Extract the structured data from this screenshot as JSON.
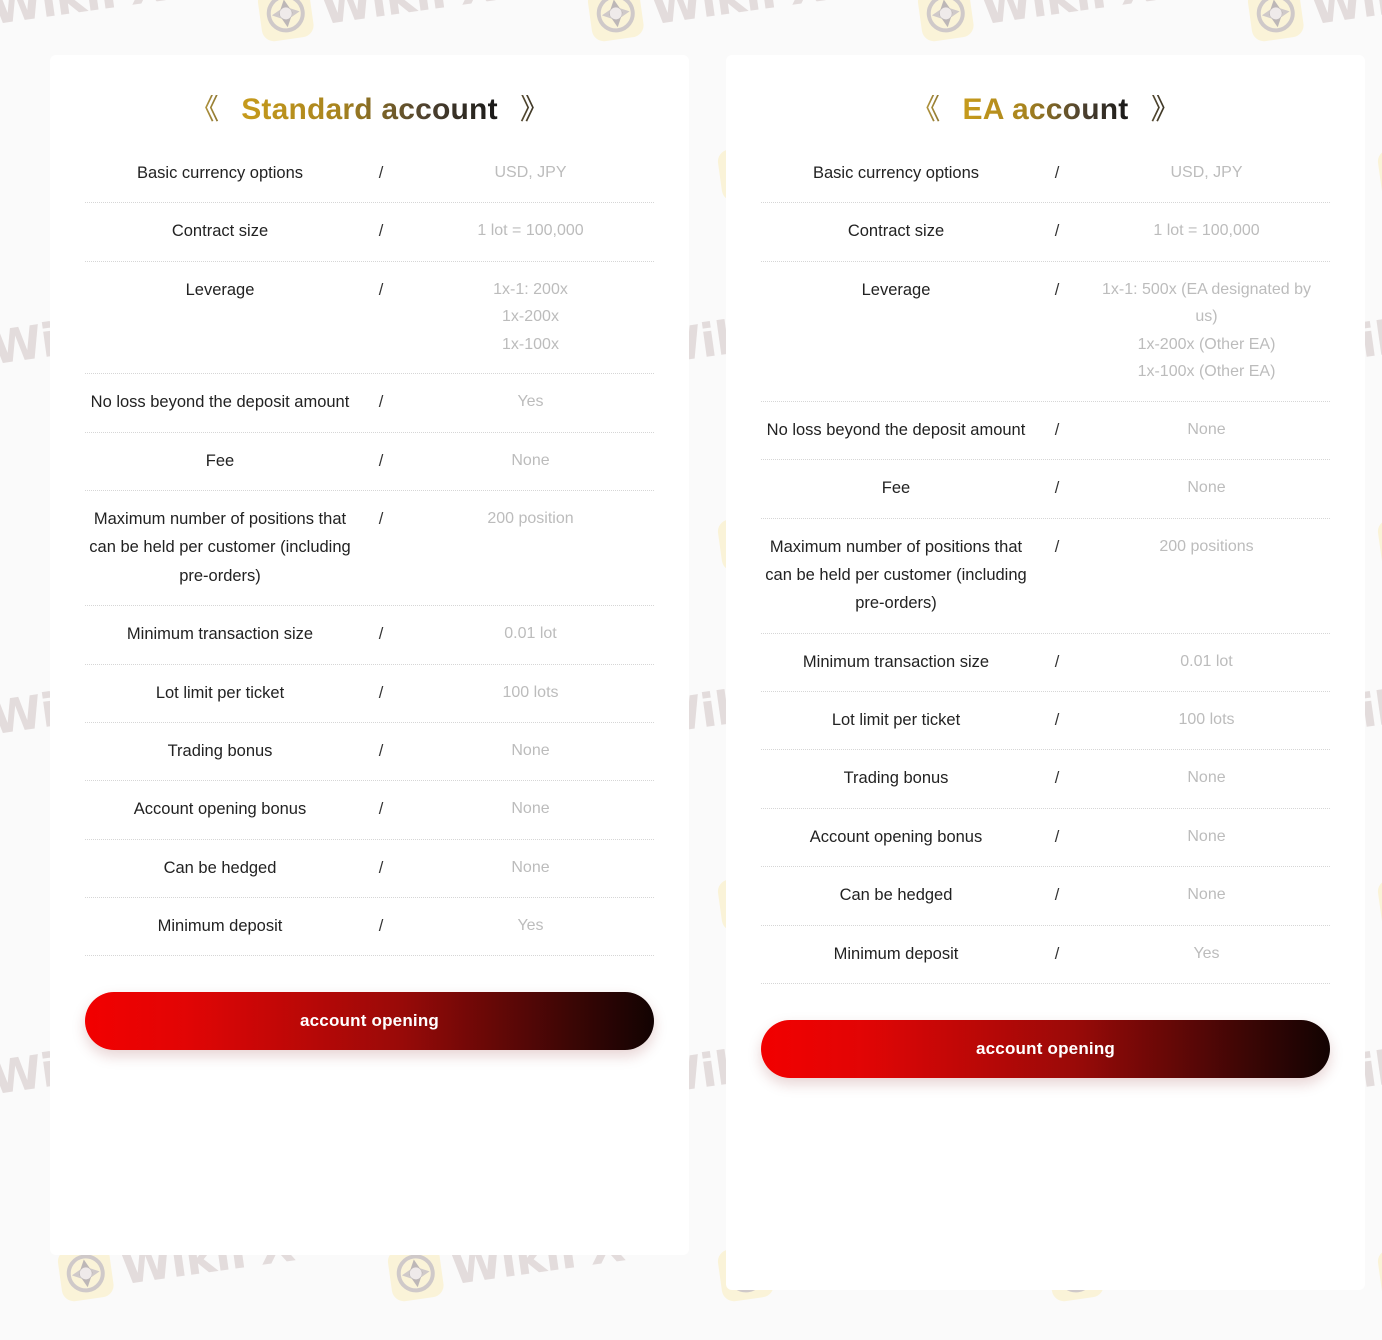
{
  "page": {
    "background_color": "#fafafa",
    "card_background_color": "#ffffff",
    "value_text_color": "#bcbcbc",
    "label_text_color": "#222222",
    "title_gradient_from": "#c79b1c",
    "title_gradient_to": "#181818",
    "cta_gradient_from": "#f20000",
    "cta_gradient_to": "#120302",
    "separator_symbol": "/"
  },
  "watermark": {
    "text": "WikiFX",
    "logo_icon": "wikifx-eagle-logo-icon",
    "color": "#e3dcdc",
    "logo_background": "#faf3d8"
  },
  "cards": [
    {
      "id": "standard-account",
      "title": "Standard account",
      "chevron_left": "《",
      "chevron_right": "》",
      "cta_label": "account opening",
      "rows": [
        {
          "label": "Basic currency options",
          "sep": "/",
          "value": "USD, JPY"
        },
        {
          "label": "Contract size",
          "sep": "/",
          "value": "1 lot = 100,000"
        },
        {
          "label": "Leverage",
          "sep": "/",
          "value": "1x-1: 200x\n1x-200x\n1x-100x"
        },
        {
          "label": "No loss beyond the deposit amount",
          "sep": "/",
          "value": "Yes"
        },
        {
          "label": "Fee",
          "sep": "/",
          "value": "None"
        },
        {
          "label": "Maximum number of positions that can be held per customer (including pre-orders)",
          "sep": "/",
          "value": "200 position"
        },
        {
          "label": "Minimum transaction size",
          "sep": "/",
          "value": "0.01 lot"
        },
        {
          "label": "Lot limit per ticket",
          "sep": "/",
          "value": "100 lots"
        },
        {
          "label": "Trading bonus",
          "sep": "/",
          "value": "None"
        },
        {
          "label": "Account opening bonus",
          "sep": "/",
          "value": "None"
        },
        {
          "label": "Can be hedged",
          "sep": "/",
          "value": "None"
        },
        {
          "label": "Minimum deposit",
          "sep": "/",
          "value": "Yes"
        }
      ]
    },
    {
      "id": "ea-account",
      "title": "EA account",
      "chevron_left": "《",
      "chevron_right": "》",
      "cta_label": "account opening",
      "rows": [
        {
          "label": "Basic currency options",
          "sep": "/",
          "value": "USD, JPY"
        },
        {
          "label": "Contract size",
          "sep": "/",
          "value": "1 lot = 100,000"
        },
        {
          "label": "Leverage",
          "sep": "/",
          "value": "1x-1: 500x (EA designated by us)\n1x-200x (Other EA)\n1x-100x (Other EA)"
        },
        {
          "label": "No loss beyond the deposit amount",
          "sep": "/",
          "value": "None"
        },
        {
          "label": "Fee",
          "sep": "/",
          "value": "None"
        },
        {
          "label": "Maximum number of positions that can be held per customer (including pre-orders)",
          "sep": "/",
          "value": "200 positions"
        },
        {
          "label": "Minimum transaction size",
          "sep": "/",
          "value": "0.01 lot"
        },
        {
          "label": "Lot limit per ticket",
          "sep": "/",
          "value": "100 lots"
        },
        {
          "label": "Trading bonus",
          "sep": "/",
          "value": "None"
        },
        {
          "label": "Account opening bonus",
          "sep": "/",
          "value": "None"
        },
        {
          "label": "Can be hedged",
          "sep": "/",
          "value": "None"
        },
        {
          "label": "Minimum deposit",
          "sep": "/",
          "value": "Yes"
        }
      ]
    }
  ]
}
